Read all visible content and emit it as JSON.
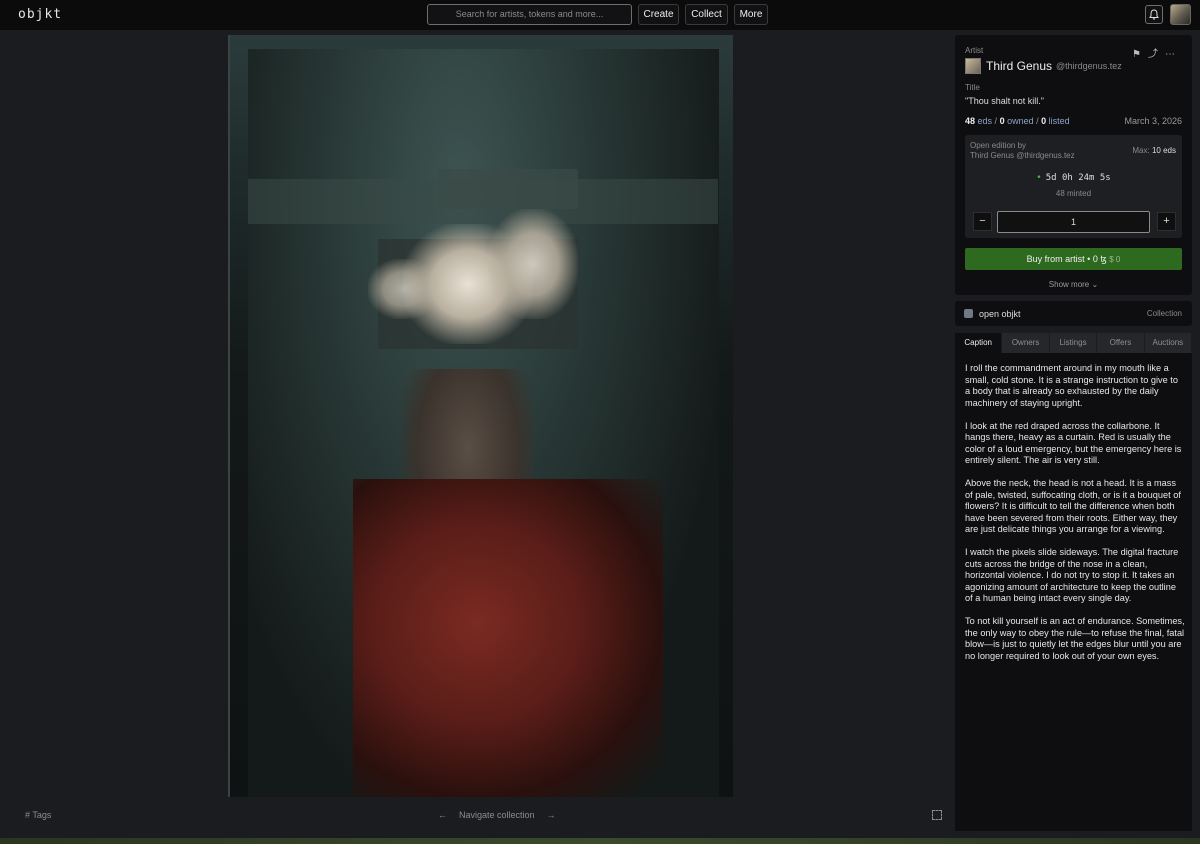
{
  "header": {
    "logo": "objkt",
    "search_placeholder": "Search for artists, tokens and more...",
    "nav": [
      "Create",
      "Collect",
      "More"
    ],
    "icons": [
      "bell-icon",
      "user-avatar"
    ]
  },
  "artwork": {
    "footer_tags": "Tags",
    "footer_nav": "Navigate collection",
    "fullscreen_icon": "fullscreen-icon"
  },
  "token": {
    "artist_label": "Artist",
    "artist_name": "Third Genus",
    "artist_handle": "@thirdgenus.tez",
    "title_label": "Title",
    "title": "\"Thou shalt not kill.\"",
    "eds": "48",
    "eds_label": "eds",
    "owned": "0",
    "owned_label": "owned",
    "listed": "0",
    "listed_label": "listed",
    "date": "March 3, 2026",
    "action_icons": [
      "bookmark-icon",
      "share-icon",
      "more-icon"
    ]
  },
  "edition": {
    "label": "Open edition by",
    "by": "Third Genus @thirdgenus.tez",
    "max_label": "Max:",
    "max_value": "10 eds",
    "countdown": "5d 0h 24m 5s",
    "minted": "48 minted",
    "quantity": "1",
    "minus": "−",
    "plus": "+",
    "buy_label": "Buy from artist",
    "buy_price": "0 ꜩ",
    "buy_usd": "$ 0",
    "show_more": "Show more ⌄"
  },
  "collection": {
    "name": "open objkt",
    "link": "Collection"
  },
  "tabs": [
    "Caption",
    "Owners",
    "Listings",
    "Offers",
    "Auctions"
  ],
  "caption": [
    "I roll the commandment around in my mouth like a small, cold stone. It is a strange instruction to give to a body that is already so exhausted by the daily machinery of staying upright.",
    "I look at the red draped across the collarbone. It hangs there, heavy as a curtain. Red is usually the color of a loud emergency, but the emergency here is entirely silent. The air is very still.",
    "Above the neck, the head is not a head. It is a mass of pale, twisted, suffocating cloth, or is it a bouquet of flowers? It is difficult to tell the difference when both have been severed from their roots. Either way, they are just delicate things you arrange for a viewing.",
    "I watch the pixels slide sideways. The digital fracture cuts across the bridge of the nose in a clean, horizontal violence. I do not try to stop it. It takes an agonizing amount of architecture to keep the outline of a human being intact every single day.",
    "To not kill yourself is an act of endurance. Sometimes, the only way to obey the rule—to refuse the final, fatal blow—is just to quietly let the edges blur until you are no longer required to look out of your own eyes."
  ]
}
